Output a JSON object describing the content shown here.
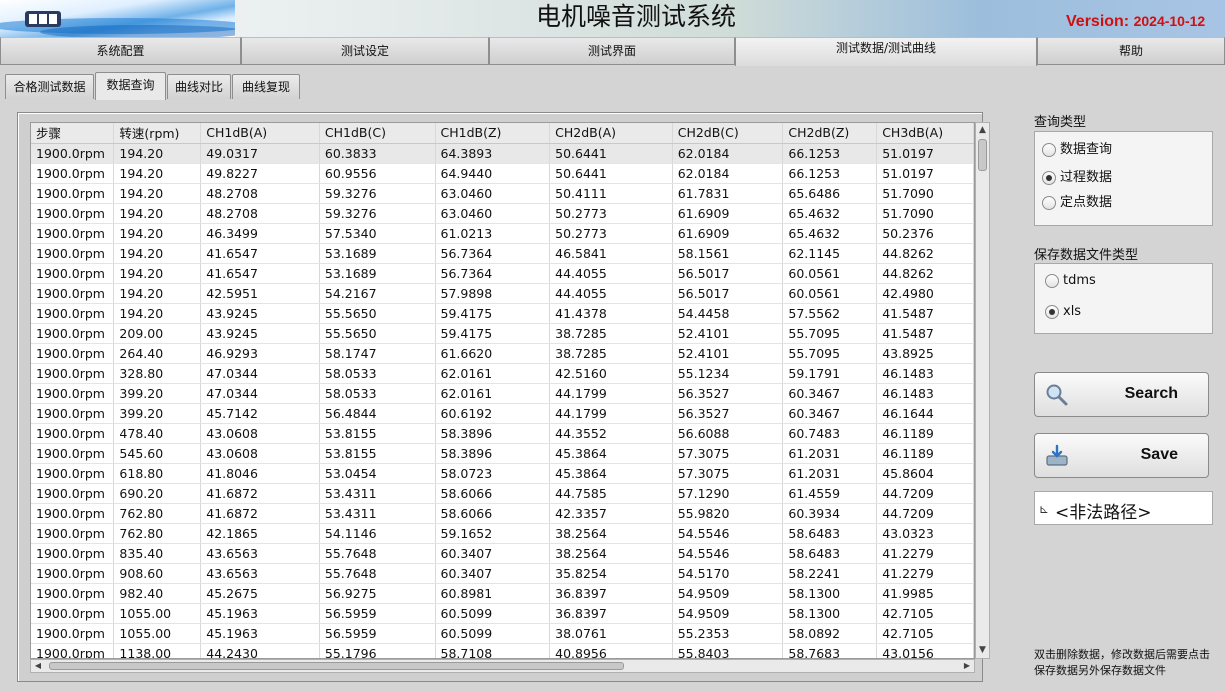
{
  "header": {
    "title": "电机噪音测试系统",
    "version_label": "Version:",
    "version_date": "2024-10-12"
  },
  "main_tabs": [
    "系统配置",
    "测试设定",
    "测试界面",
    "测试数据/测试曲线",
    "帮助"
  ],
  "sub_tabs": [
    "合格测试数据",
    "数据查询",
    "曲线对比",
    "曲线复现"
  ],
  "table": {
    "columns": [
      "步骤",
      "转速(rpm)",
      "CH1dB(A)",
      "CH1dB(C)",
      "CH1dB(Z)",
      "CH2dB(A)",
      "CH2dB(C)",
      "CH2dB(Z)",
      "CH3dB(A)"
    ],
    "rows": [
      [
        "1900.0rpm",
        "194.20",
        "49.0317",
        "60.3833",
        "64.3893",
        "50.6441",
        "62.0184",
        "66.1253",
        "51.0197"
      ],
      [
        "1900.0rpm",
        "194.20",
        "49.8227",
        "60.9556",
        "64.9440",
        "50.6441",
        "62.0184",
        "66.1253",
        "51.0197"
      ],
      [
        "1900.0rpm",
        "194.20",
        "48.2708",
        "59.3276",
        "63.0460",
        "50.4111",
        "61.7831",
        "65.6486",
        "51.7090"
      ],
      [
        "1900.0rpm",
        "194.20",
        "48.2708",
        "59.3276",
        "63.0460",
        "50.2773",
        "61.6909",
        "65.4632",
        "51.7090"
      ],
      [
        "1900.0rpm",
        "194.20",
        "46.3499",
        "57.5340",
        "61.0213",
        "50.2773",
        "61.6909",
        "65.4632",
        "50.2376"
      ],
      [
        "1900.0rpm",
        "194.20",
        "41.6547",
        "53.1689",
        "56.7364",
        "46.5841",
        "58.1561",
        "62.1145",
        "44.8262"
      ],
      [
        "1900.0rpm",
        "194.20",
        "41.6547",
        "53.1689",
        "56.7364",
        "44.4055",
        "56.5017",
        "60.0561",
        "44.8262"
      ],
      [
        "1900.0rpm",
        "194.20",
        "42.5951",
        "54.2167",
        "57.9898",
        "44.4055",
        "56.5017",
        "60.0561",
        "42.4980"
      ],
      [
        "1900.0rpm",
        "194.20",
        "43.9245",
        "55.5650",
        "59.4175",
        "41.4378",
        "54.4458",
        "57.5562",
        "41.5487"
      ],
      [
        "1900.0rpm",
        "209.00",
        "43.9245",
        "55.5650",
        "59.4175",
        "38.7285",
        "52.4101",
        "55.7095",
        "41.5487"
      ],
      [
        "1900.0rpm",
        "264.40",
        "46.9293",
        "58.1747",
        "61.6620",
        "38.7285",
        "52.4101",
        "55.7095",
        "43.8925"
      ],
      [
        "1900.0rpm",
        "328.80",
        "47.0344",
        "58.0533",
        "62.0161",
        "42.5160",
        "55.1234",
        "59.1791",
        "46.1483"
      ],
      [
        "1900.0rpm",
        "399.20",
        "47.0344",
        "58.0533",
        "62.0161",
        "44.1799",
        "56.3527",
        "60.3467",
        "46.1483"
      ],
      [
        "1900.0rpm",
        "399.20",
        "45.7142",
        "56.4844",
        "60.6192",
        "44.1799",
        "56.3527",
        "60.3467",
        "46.1644"
      ],
      [
        "1900.0rpm",
        "478.40",
        "43.0608",
        "53.8155",
        "58.3896",
        "44.3552",
        "56.6088",
        "60.7483",
        "46.1189"
      ],
      [
        "1900.0rpm",
        "545.60",
        "43.0608",
        "53.8155",
        "58.3896",
        "45.3864",
        "57.3075",
        "61.2031",
        "46.1189"
      ],
      [
        "1900.0rpm",
        "618.80",
        "41.8046",
        "53.0454",
        "58.0723",
        "45.3864",
        "57.3075",
        "61.2031",
        "45.8604"
      ],
      [
        "1900.0rpm",
        "690.20",
        "41.6872",
        "53.4311",
        "58.6066",
        "44.7585",
        "57.1290",
        "61.4559",
        "44.7209"
      ],
      [
        "1900.0rpm",
        "762.80",
        "41.6872",
        "53.4311",
        "58.6066",
        "42.3357",
        "55.9820",
        "60.3934",
        "44.7209"
      ],
      [
        "1900.0rpm",
        "762.80",
        "42.1865",
        "54.1146",
        "59.1652",
        "38.2564",
        "54.5546",
        "58.6483",
        "43.0323"
      ],
      [
        "1900.0rpm",
        "835.40",
        "43.6563",
        "55.7648",
        "60.3407",
        "38.2564",
        "54.5546",
        "58.6483",
        "41.2279"
      ],
      [
        "1900.0rpm",
        "908.60",
        "43.6563",
        "55.7648",
        "60.3407",
        "35.8254",
        "54.5170",
        "58.2241",
        "41.2279"
      ],
      [
        "1900.0rpm",
        "982.40",
        "45.2675",
        "56.9275",
        "60.8981",
        "36.8397",
        "54.9509",
        "58.1300",
        "41.9985"
      ],
      [
        "1900.0rpm",
        "1055.00",
        "45.1963",
        "56.5959",
        "60.5099",
        "36.8397",
        "54.9509",
        "58.1300",
        "42.7105"
      ],
      [
        "1900.0rpm",
        "1055.00",
        "45.1963",
        "56.5959",
        "60.5099",
        "38.0761",
        "55.2353",
        "58.0892",
        "42.7105"
      ],
      [
        "1900.0rpm",
        "1138.00",
        "44.2430",
        "55.1796",
        "58.7108",
        "40.8956",
        "55.8403",
        "58.7683",
        "43.0156"
      ]
    ]
  },
  "query": {
    "label": "查询类型",
    "options": [
      "数据查询",
      "过程数据",
      "定点数据"
    ],
    "selected": "过程数据"
  },
  "save_type": {
    "label": "保存数据文件类型",
    "options": [
      "tdms",
      "xls"
    ],
    "selected": "xls"
  },
  "buttons": {
    "search": "Search",
    "save": "Save"
  },
  "path": {
    "value": "<非法路径>"
  },
  "hint": "双击删除数据，修改数据后需要点击保存数据另外保存数据文件",
  "colors": {
    "version": "#d01010",
    "panel": "#d4d4d4"
  }
}
